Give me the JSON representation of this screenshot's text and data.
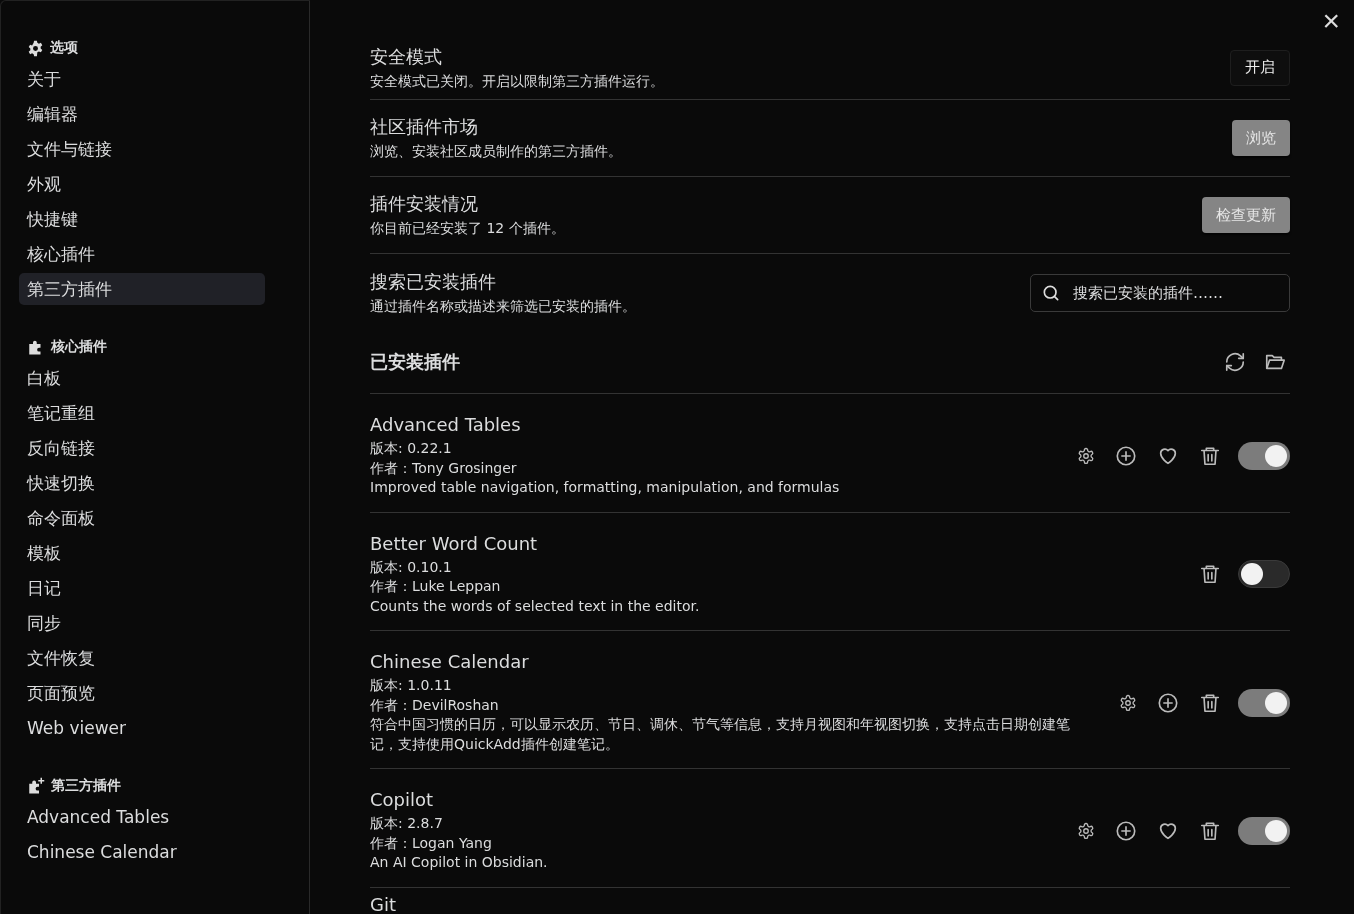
{
  "sidebar": {
    "sections": [
      {
        "title": "选项",
        "items": [
          {
            "label": "关于",
            "selected": false
          },
          {
            "label": "编辑器",
            "selected": false
          },
          {
            "label": "文件与链接",
            "selected": false
          },
          {
            "label": "外观",
            "selected": false
          },
          {
            "label": "快捷键",
            "selected": false
          },
          {
            "label": "核心插件",
            "selected": false
          },
          {
            "label": "第三方插件",
            "selected": true
          }
        ]
      },
      {
        "title": "核心插件",
        "items": [
          {
            "label": "白板",
            "selected": false
          },
          {
            "label": "笔记重组",
            "selected": false
          },
          {
            "label": "反向链接",
            "selected": false
          },
          {
            "label": "快速切换",
            "selected": false
          },
          {
            "label": "命令面板",
            "selected": false
          },
          {
            "label": "模板",
            "selected": false
          },
          {
            "label": "日记",
            "selected": false
          },
          {
            "label": "同步",
            "selected": false
          },
          {
            "label": "文件恢复",
            "selected": false
          },
          {
            "label": "页面预览",
            "selected": false
          },
          {
            "label": "Web viewer",
            "selected": false
          }
        ]
      },
      {
        "title": "第三方插件",
        "items": [
          {
            "label": "Advanced Tables",
            "selected": false
          },
          {
            "label": "Chinese Calendar",
            "selected": false
          }
        ]
      }
    ]
  },
  "close": "×",
  "settings": [
    {
      "title": "安全模式",
      "description": "安全模式已关闭。开启以限制第三方插件运行。",
      "kind": "button",
      "button": "开启"
    },
    {
      "title": "社区插件市场",
      "description": "浏览、安装社区成员制作的第三方插件。",
      "kind": "accent-button",
      "button": "浏览"
    },
    {
      "title": "插件安装情况",
      "description": "你目前已经安装了 12 个插件。",
      "kind": "accent-button",
      "button": "检查更新"
    },
    {
      "title": "搜索已安装插件",
      "description": "通过插件名称或描述来筛选已安装的插件。",
      "kind": "search",
      "placeholder": "搜索已安装的插件……"
    }
  ],
  "installed": {
    "heading": "已安装插件",
    "plugins": [
      {
        "name": "Advanced Tables",
        "version": "版本: 0.22.1",
        "author": "作者：Tony Grosinger",
        "description": "Improved table navigation, formatting, manipulation, and formulas",
        "actions": [
          {
            "kind": "settings"
          },
          {
            "kind": "hotkey"
          },
          {
            "kind": "favorite"
          },
          {
            "kind": "delete"
          }
        ],
        "on": true
      },
      {
        "name": "Better Word Count",
        "version": "版本: 0.10.1",
        "author": "作者：Luke Leppan",
        "description": "Counts the words of selected text in the editor.",
        "actions": [
          {
            "kind": "delete"
          }
        ],
        "on": false
      },
      {
        "name": "Chinese Calendar",
        "version": "版本: 1.0.11",
        "author": "作者：DevilRoshan",
        "description": "符合中国习惯的日历，可以显示农历、节日、调休、节气等信息，支持月视图和年视图切换，支持点击日期创建笔记，支持使用QuickAdd插件创建笔记。",
        "actions": [
          {
            "kind": "settings"
          },
          {
            "kind": "hotkey"
          },
          {
            "kind": "delete"
          }
        ],
        "on": true
      },
      {
        "name": "Copilot",
        "version": "版本: 2.8.7",
        "author": "作者：Logan Yang",
        "description": "An AI Copilot in Obsidian.",
        "actions": [
          {
            "kind": "settings"
          },
          {
            "kind": "hotkey"
          },
          {
            "kind": "favorite"
          },
          {
            "kind": "delete"
          }
        ],
        "on": true
      },
      {
        "name": "Git"
      }
    ]
  }
}
